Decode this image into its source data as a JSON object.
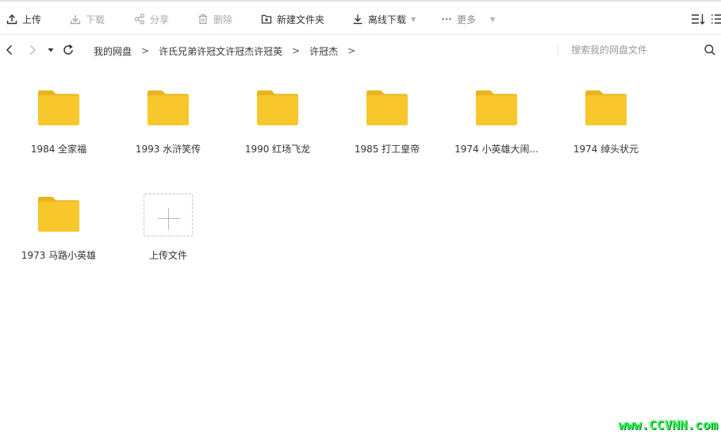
{
  "toolbar": {
    "upload": "上传",
    "download": "下载",
    "share": "分享",
    "delete": "删除",
    "new_folder": "新建文件夹",
    "offline_download": "离线下载",
    "more": "更多"
  },
  "nav": {
    "breadcrumbs": [
      "我的网盘",
      "许氏兄弟许冠文许冠杰许冠英",
      "许冠杰"
    ],
    "separator": ">",
    "search_placeholder": "搜索我的网盘文件"
  },
  "folders": [
    {
      "name": "1984 全家福"
    },
    {
      "name": "1993 水浒笑传"
    },
    {
      "name": "1990 红场飞龙"
    },
    {
      "name": "1985 打工皇帝"
    },
    {
      "name": "1974 小英雄大闹..."
    },
    {
      "name": "1974 绰头状元"
    },
    {
      "name": "1973 马路小英雄"
    }
  ],
  "upload_tile": {
    "label": "上传文件"
  },
  "icons": [
    "upload-icon",
    "download-icon",
    "share-icon",
    "delete-icon",
    "new-folder-icon",
    "offline-download-icon",
    "more-icon",
    "sort-icon",
    "list-view-icon",
    "back-icon",
    "forward-icon",
    "refresh-icon",
    "search-icon",
    "folder-icon",
    "plus-icon"
  ],
  "colors": {
    "folder": "#f7c72c",
    "folder_tab": "#e8b51f",
    "disabled": "#a8a8a8",
    "watermark": "#32ff5a"
  },
  "watermark": "www.CCVNN.com"
}
